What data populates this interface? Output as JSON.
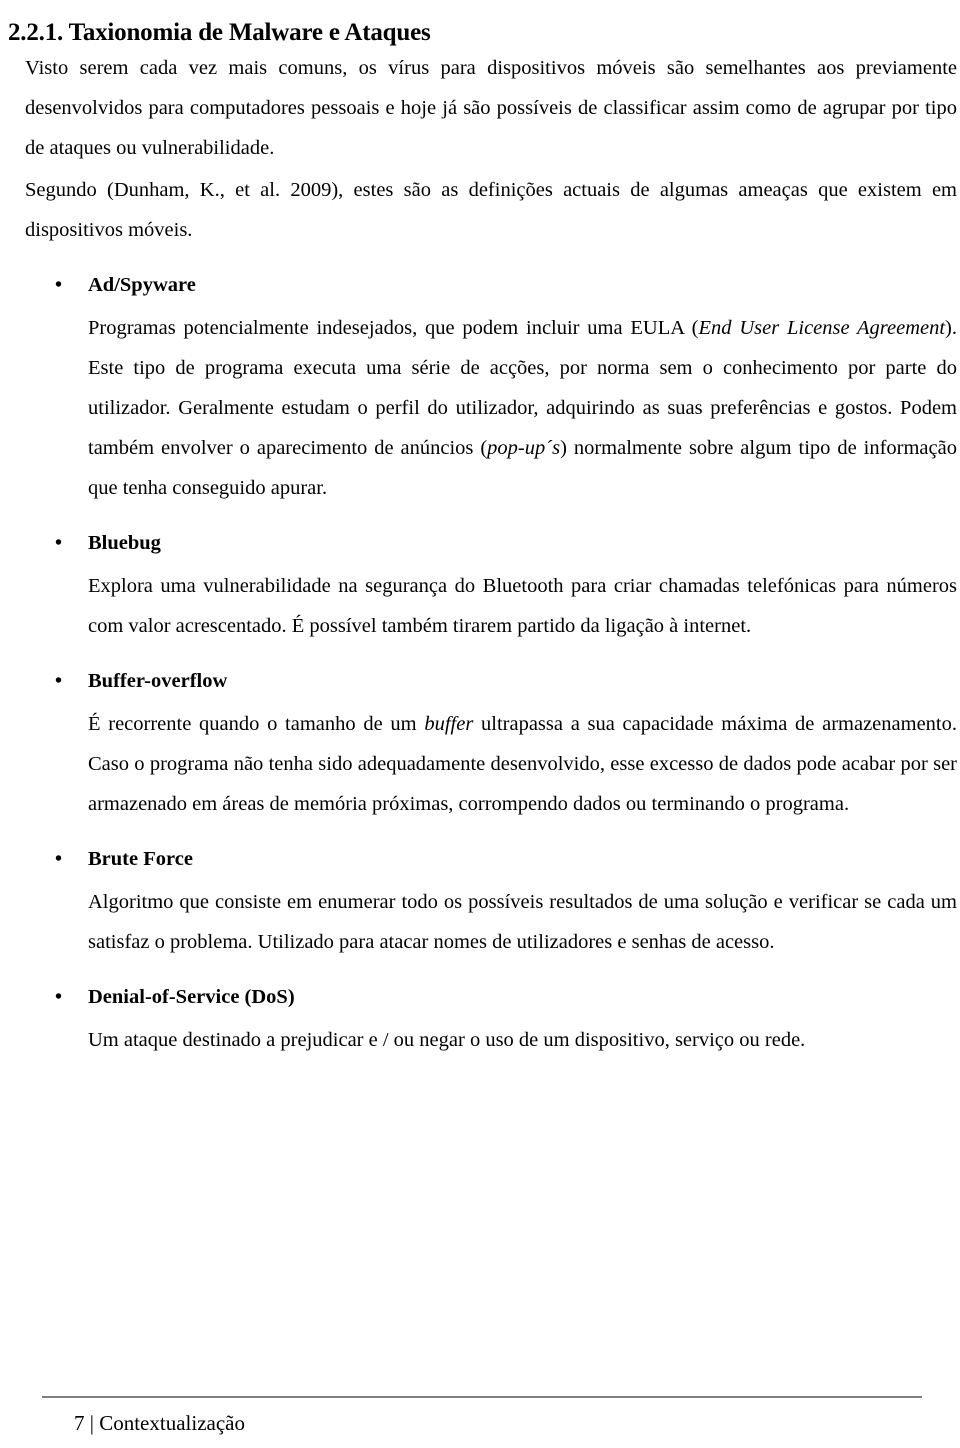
{
  "document": {
    "heading": "2.2.1. Taxionomia de Malware e Ataques",
    "intro_paragraphs": [
      "Visto serem cada vez mais comuns, os vírus para dispositivos móveis são semelhantes aos previamente desenvolvidos para computadores pessoais e hoje já são possíveis de classificar assim como de agrupar por tipo de ataques ou vulnerabilidade.",
      "Segundo (Dunham, K., et al. 2009), estes são as definições actuais de algumas ameaças que existem em dispositivos móveis."
    ],
    "bullet_glyph": "•",
    "terms": [
      {
        "name": "Ad/Spyware",
        "body_pre": "Programas potencialmente indesejados, que podem incluir uma EULA (",
        "body_italic": "End User License Agreement",
        "body_mid": "). Este tipo de programa executa uma série de acções, por norma sem o conhecimento por parte do utilizador. Geralmente estudam o perfil do utilizador, adquirindo as suas preferências e gostos. Podem também envolver o aparecimento de anúncios (",
        "body_italic2": "pop-up´s",
        "body_post": ") normalmente sobre algum tipo de informação que tenha conseguido apurar."
      },
      {
        "name": "Bluebug",
        "body": "Explora uma vulnerabilidade na segurança do Bluetooth para criar chamadas telefónicas para números com valor acrescentado. É possível também tirarem partido da ligação à internet."
      },
      {
        "name": "Buffer-overflow",
        "body_pre": "É recorrente quando o tamanho de um ",
        "body_italic": "buffer",
        "body_post": " ultrapassa a sua capacidade máxima de armazenamento. Caso o programa não tenha sido adequadamente desenvolvido, esse excesso de dados pode acabar por ser armazenado em áreas de memória próximas, corrompendo dados ou terminando o programa."
      },
      {
        "name": "Brute Force",
        "body": "Algoritmo que consiste em enumerar todo os possíveis resultados de uma solução e verificar se cada um satisfaz o problema. Utilizado para atacar nomes de utilizadores e senhas de acesso."
      },
      {
        "name": "Denial-of-Service (DoS)",
        "body": "Um ataque destinado a prejudicar e / ou negar o uso de um dispositivo, serviço ou rede."
      }
    ],
    "footer": {
      "text": "7 | Contextualização",
      "rule_color": "#808080"
    }
  }
}
